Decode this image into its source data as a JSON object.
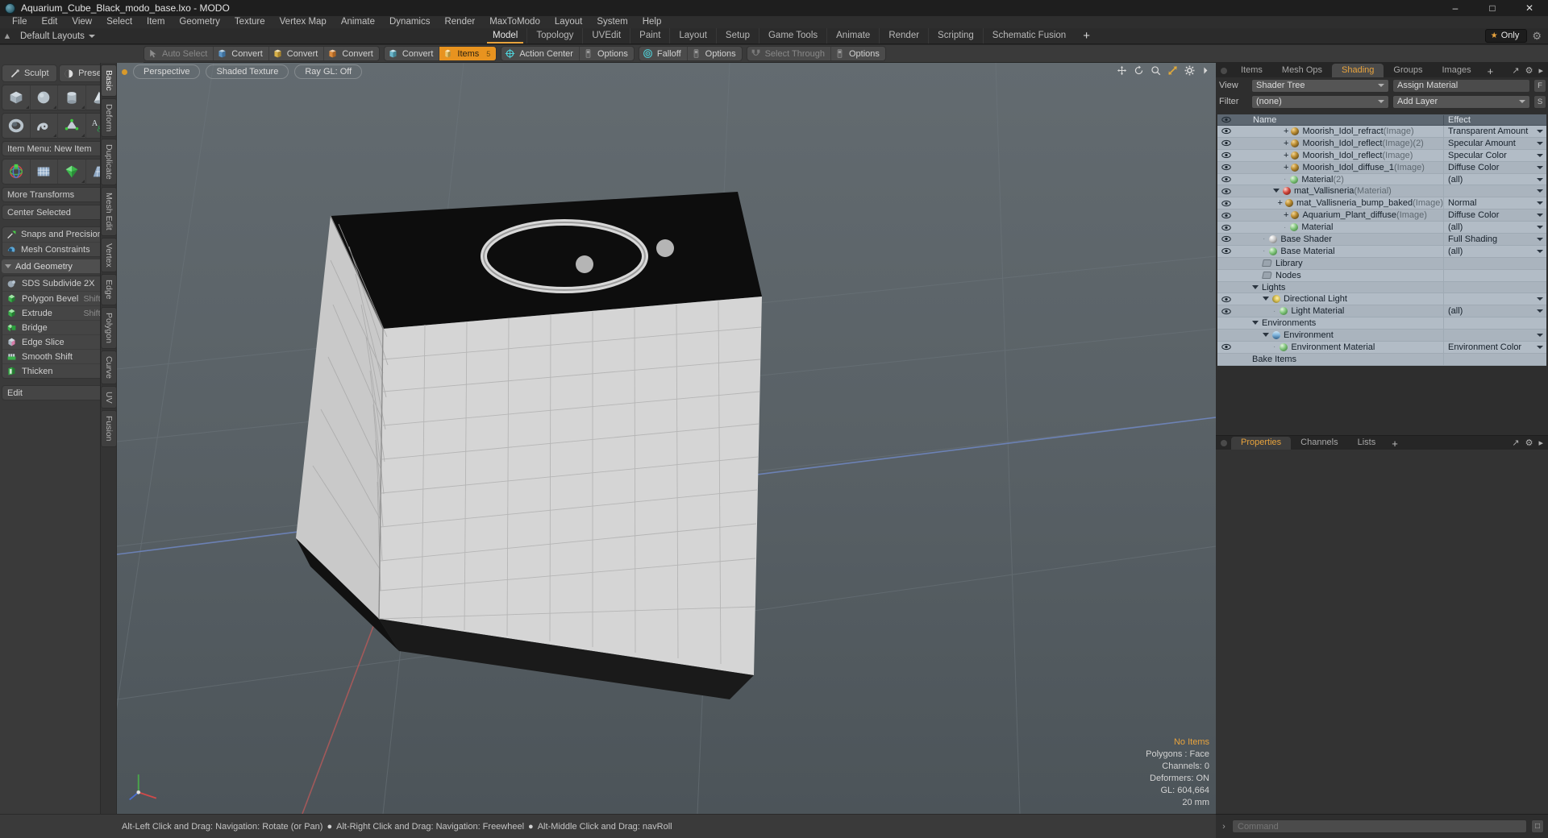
{
  "window": {
    "title": "Aquarium_Cube_Black_modo_base.lxo - MODO",
    "app_icon": "modo-logo-icon",
    "minimize": "–",
    "maximize": "□",
    "close": "✕"
  },
  "menubar": {
    "items": [
      "File",
      "Edit",
      "View",
      "Select",
      "Item",
      "Geometry",
      "Texture",
      "Vertex Map",
      "Animate",
      "Dynamics",
      "Render",
      "MaxToModo",
      "Layout",
      "System",
      "Help"
    ]
  },
  "layoutbar": {
    "pin_icon": "pin-icon",
    "default_layouts": "Default Layouts",
    "tabs": [
      "Model",
      "Topology",
      "UVEdit",
      "Paint",
      "Layout",
      "Setup",
      "Game Tools",
      "Animate",
      "Render",
      "Scripting",
      "Schematic Fusion"
    ],
    "active_tab": "Model",
    "add_tab": "+",
    "only_label": "Only",
    "star_icon": "star-icon",
    "gear_icon": "gear-icon"
  },
  "modebar": {
    "groups": [
      {
        "buttons": [
          {
            "label": "Auto Select",
            "icon": "cursor-icon",
            "state": "dim"
          },
          {
            "label": "Convert",
            "icon": "convert-blue-icon",
            "state": "normal"
          },
          {
            "label": "Convert",
            "icon": "convert-yellow-icon",
            "state": "normal"
          },
          {
            "label": "Convert",
            "icon": "convert-orange-icon",
            "state": "normal"
          }
        ]
      },
      {
        "buttons": [
          {
            "label": "Convert",
            "icon": "convert-cyan-icon",
            "state": "normal"
          },
          {
            "label": "Items",
            "icon": "items-icon",
            "state": "active",
            "badge": "5"
          }
        ]
      },
      {
        "buttons": [
          {
            "label": "Action Center",
            "icon": "action-center-icon",
            "state": "normal"
          },
          {
            "label": "Options",
            "icon": "options-icon",
            "state": "normal"
          }
        ]
      },
      {
        "buttons": [
          {
            "label": "Falloff",
            "icon": "falloff-icon",
            "state": "normal"
          },
          {
            "label": "Options",
            "icon": "options-icon",
            "state": "normal"
          }
        ]
      },
      {
        "buttons": [
          {
            "label": "Select Through",
            "icon": "select-through-icon",
            "state": "dim"
          },
          {
            "label": "Options",
            "icon": "options-icon",
            "state": "normal"
          }
        ]
      }
    ]
  },
  "left_panel": {
    "tabs": [
      {
        "label": "Sculpt",
        "icon": "sculpt-brush-icon"
      },
      {
        "label": "Presets",
        "icon": "presets-sphere-icon"
      }
    ],
    "primitive_row_1": [
      "cube-icon",
      "sphere-icon",
      "cylinder-icon",
      "cone-icon"
    ],
    "primitive_row_2": [
      "torus-icon",
      "spiral-icon",
      "polygon-pen-icon",
      "text-icon"
    ],
    "item_menu": "Item Menu: New Item",
    "transform_row": [
      "transform-gizmo-icon",
      "bend-grid-icon",
      "green-deform-icon",
      "taper-grid-icon"
    ],
    "more_transforms": "More Transforms",
    "center_selected": "Center Selected",
    "toggles": [
      {
        "label": "Snaps and Precision",
        "icon": "snap-icon"
      },
      {
        "label": "Mesh Constraints",
        "icon": "mesh-constraint-icon"
      }
    ],
    "add_geometry_header": "Add Geometry",
    "geometry_items": [
      {
        "label": "SDS Subdivide 2X",
        "icon": "sds-subdivide-icon",
        "shortcut": ""
      },
      {
        "label": "Polygon Bevel",
        "icon": "polygon-bevel-icon",
        "shortcut": "Shift-B"
      },
      {
        "label": "Extrude",
        "icon": "extrude-icon",
        "shortcut": "Shift-X"
      },
      {
        "label": "Bridge",
        "icon": "bridge-icon",
        "shortcut": ""
      },
      {
        "label": "Edge Slice",
        "icon": "edge-slice-icon",
        "shortcut": ""
      },
      {
        "label": "Smooth Shift",
        "icon": "smooth-shift-icon",
        "shortcut": ""
      },
      {
        "label": "Thicken",
        "icon": "thicken-icon",
        "shortcut": ""
      }
    ],
    "edit_dropdown": "Edit",
    "vertical_tabs": [
      "Basic",
      "Deform",
      "Duplicate",
      "Mesh Edit",
      "Vertex",
      "Edge",
      "Polygon",
      "Curve",
      "UV",
      "Fusion"
    ],
    "vertical_active": "Basic"
  },
  "viewport": {
    "view_mode": "Perspective",
    "shading_mode": "Shaded Texture",
    "raygl": "Ray GL: Off",
    "dot_icon": "viewport-state-dot",
    "tool_icons": [
      "pan-icon",
      "rotate-icon",
      "zoom-icon",
      "fit-icon",
      "gear-icon",
      "chevron-right-icon"
    ],
    "stats": {
      "items": "No Items",
      "polygons": "Polygons : Face",
      "channels": "Channels: 0",
      "deformers": "Deformers: ON",
      "gl": "GL: 604,664",
      "grid_size": "20 mm"
    },
    "axis_gizmo": "axis-gizmo-icon"
  },
  "right_panel": {
    "tabs": [
      "Items",
      "Mesh Ops",
      "Shading",
      "Groups",
      "Images"
    ],
    "active_tab": "Shading",
    "add_tab": "+",
    "header_icons": [
      "expand-icon",
      "gear-icon",
      "chevron-right-icon"
    ],
    "view_label": "View",
    "view_value": "Shader Tree",
    "assign_material": "Assign Material",
    "assign_material_btn": "F",
    "filter_label": "Filter",
    "filter_value": "(none)",
    "add_layer": "Add Layer",
    "add_layer_btn": "S",
    "columns": {
      "name": "Name",
      "effect": "Effect"
    },
    "rows": [
      {
        "eye": true,
        "depth": 4,
        "expander": "plus",
        "icon": "gold-sphere-icon",
        "name": "Moorish_Idol_refract",
        "type": "(Image)",
        "suffix": "",
        "effect": "Transparent Amount"
      },
      {
        "eye": true,
        "depth": 4,
        "expander": "plus",
        "icon": "gold-sphere-icon",
        "name": "Moorish_Idol_reflect",
        "type": "(Image)",
        "suffix": "(2)",
        "effect": "Specular Amount"
      },
      {
        "eye": true,
        "depth": 4,
        "expander": "plus",
        "icon": "gold-sphere-icon",
        "name": "Moorish_Idol_reflect",
        "type": "(Image)",
        "suffix": "",
        "effect": "Specular Color"
      },
      {
        "eye": true,
        "depth": 4,
        "expander": "plus",
        "icon": "gold-sphere-icon",
        "name": "Moorish_Idol_diffuse_1",
        "type": "(Image)",
        "suffix": "",
        "effect": "Diffuse Color"
      },
      {
        "eye": true,
        "depth": 4,
        "expander": "leaf",
        "icon": "green-sphere-icon",
        "name": "Material",
        "type": "",
        "suffix": "(2)",
        "effect": "(all)"
      },
      {
        "eye": true,
        "depth": 3,
        "expander": "open",
        "icon": "red-sphere-icon",
        "name": "mat_Vallisneria",
        "type": "(Material)",
        "suffix": "",
        "effect": ""
      },
      {
        "eye": true,
        "depth": 4,
        "expander": "plus",
        "icon": "gold-sphere-icon",
        "name": "mat_Vallisneria_bump_baked",
        "type": "(Image)",
        "suffix": "",
        "effect": "Normal"
      },
      {
        "eye": true,
        "depth": 4,
        "expander": "plus",
        "icon": "gold-sphere-icon",
        "name": "Aquarium_Plant_diffuse",
        "type": "(Image)",
        "suffix": "",
        "effect": "Diffuse Color"
      },
      {
        "eye": true,
        "depth": 4,
        "expander": "leaf",
        "icon": "green-sphere-icon",
        "name": "Material",
        "type": "",
        "suffix": "",
        "effect": "(all)"
      },
      {
        "eye": true,
        "depth": 2,
        "expander": "leaf",
        "icon": "white-sphere-icon",
        "name": "Base Shader",
        "type": "",
        "suffix": "",
        "effect": "Full Shading"
      },
      {
        "eye": true,
        "depth": 2,
        "expander": "leaf",
        "icon": "green-sphere-icon",
        "name": "Base Material",
        "type": "",
        "suffix": "",
        "effect": "(all)"
      },
      {
        "eye": false,
        "depth": 2,
        "expander": "none",
        "icon": "folder-icon",
        "name": "Library",
        "type": "",
        "suffix": "",
        "effect": ""
      },
      {
        "eye": false,
        "depth": 2,
        "expander": "none",
        "icon": "folder-icon",
        "name": "Nodes",
        "type": "",
        "suffix": "",
        "effect": ""
      },
      {
        "eye": false,
        "depth": 1,
        "expander": "open",
        "icon": "none",
        "name": "Lights",
        "type": "",
        "suffix": "",
        "effect": ""
      },
      {
        "eye": true,
        "depth": 2,
        "expander": "open",
        "icon": "light-icon",
        "name": "Directional Light",
        "type": "",
        "suffix": "",
        "effect": ""
      },
      {
        "eye": true,
        "depth": 3,
        "expander": "leaf",
        "icon": "green-sphere-icon",
        "name": "Light Material",
        "type": "",
        "suffix": "",
        "effect": "(all)"
      },
      {
        "eye": false,
        "depth": 1,
        "expander": "open",
        "icon": "none",
        "name": "Environments",
        "type": "",
        "suffix": "",
        "effect": ""
      },
      {
        "eye": false,
        "depth": 2,
        "expander": "open",
        "icon": "env-icon",
        "name": "Environment",
        "type": "",
        "suffix": "",
        "effect": ""
      },
      {
        "eye": true,
        "depth": 3,
        "expander": "leaf",
        "icon": "green-sphere-icon",
        "name": "Environment Material",
        "type": "",
        "suffix": "",
        "effect": "Environment Color"
      },
      {
        "eye": false,
        "depth": 1,
        "expander": "none",
        "icon": "none",
        "name": "Bake Items",
        "type": "",
        "suffix": "",
        "effect": ""
      }
    ]
  },
  "properties_panel": {
    "tabs": [
      "Properties",
      "Channels",
      "Lists"
    ],
    "active_tab": "Properties",
    "add_tab": "+",
    "header_icons": [
      "expand-icon",
      "gear-icon",
      "chevron-right-icon"
    ]
  },
  "statusbar": {
    "hints": [
      "Alt-Left Click and Drag: Navigation: Rotate (or Pan)",
      "Alt-Right Click and Drag: Navigation: Freewheel",
      "Alt-Middle Click and Drag: navRoll"
    ],
    "separator": "●"
  },
  "commandbar": {
    "arrow": "›",
    "placeholder": "Command",
    "value": "",
    "button": "□"
  },
  "colors": {
    "accent": "#e8a33d",
    "active_mode": "#e8931f",
    "tree_bg": "#aab4be",
    "panel_bg": "#2e2e2e",
    "toolbar_bg": "#3a3a3a"
  }
}
